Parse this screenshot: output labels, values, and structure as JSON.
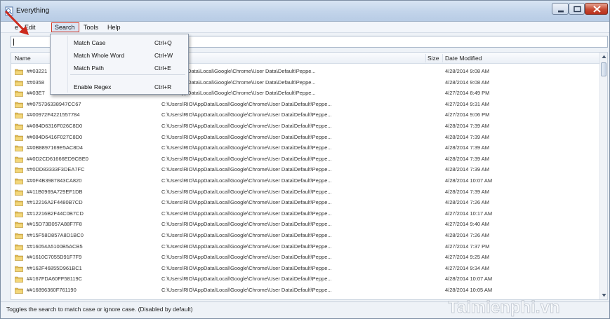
{
  "window": {
    "title": "Everything"
  },
  "menubar": {
    "items": [
      {
        "label": "File",
        "visible_text": "e"
      },
      {
        "label": "Edit"
      },
      {
        "label": "Search"
      },
      {
        "label": "Tools"
      },
      {
        "label": "Help"
      }
    ]
  },
  "search": {
    "value": ""
  },
  "columns": {
    "name": "Name",
    "size": "Size",
    "date": "Date Modified"
  },
  "dropdown": {
    "items": [
      {
        "label": "Match Case",
        "shortcut": "Ctrl+Q"
      },
      {
        "label": "Match Whole Word",
        "shortcut": "Ctrl+W"
      },
      {
        "label": "Match Path",
        "shortcut": "Ctrl+E"
      },
      {
        "label": "Enable Regex",
        "shortcut": "Ctrl+R"
      }
    ]
  },
  "rows": [
    {
      "name": "##03221",
      "path": "...\\RIO\\AppData\\Local\\Google\\Chrome\\User Data\\Default\\Peppe...",
      "date": "4/28/2014 9:08 AM"
    },
    {
      "name": "##0358",
      "path": "...\\RIO\\AppData\\Local\\Google\\Chrome\\User Data\\Default\\Peppe...",
      "date": "4/28/2014 9:08 AM"
    },
    {
      "name": "##03E7",
      "path": "...\\RIO\\AppData\\Local\\Google\\Chrome\\User Data\\Default\\Peppe...",
      "date": "4/27/2014 8:49 PM"
    },
    {
      "name": "##075736338947CC67",
      "path": "C:\\Users\\RIO\\AppData\\Local\\Google\\Chrome\\User Data\\Default\\Peppe...",
      "date": "4/27/2014 9:31 AM"
    },
    {
      "name": "##00972F4221557784",
      "path": "C:\\Users\\RIO\\AppData\\Local\\Google\\Chrome\\User Data\\Default\\Peppe...",
      "date": "4/27/2014 9:06 PM"
    },
    {
      "name": "##084D6316F026C8D0",
      "path": "C:\\Users\\RIO\\AppData\\Local\\Google\\Chrome\\User Data\\Default\\Peppe...",
      "date": "4/28/2014 7:39 AM"
    },
    {
      "name": "##084D6416F027C8D0",
      "path": "C:\\Users\\RIO\\AppData\\Local\\Google\\Chrome\\User Data\\Default\\Peppe...",
      "date": "4/28/2014 7:39 AM"
    },
    {
      "name": "##0B8897169E5AC8D4",
      "path": "C:\\Users\\RIO\\AppData\\Local\\Google\\Chrome\\User Data\\Default\\Peppe...",
      "date": "4/28/2014 7:39 AM"
    },
    {
      "name": "##0D2CD61666ED9CBE0",
      "path": "C:\\Users\\RIO\\AppData\\Local\\Google\\Chrome\\User Data\\Default\\Peppe...",
      "date": "4/28/2014 7:39 AM"
    },
    {
      "name": "##0DD83333F3DEA7FC",
      "path": "C:\\Users\\RIO\\AppData\\Local\\Google\\Chrome\\User Data\\Default\\Peppe...",
      "date": "4/28/2014 7:39 AM"
    },
    {
      "name": "##0F4B3987843CA820",
      "path": "C:\\Users\\RIO\\AppData\\Local\\Google\\Chrome\\User Data\\Default\\Peppe...",
      "date": "4/28/2014 10:07 AM"
    },
    {
      "name": "##11B0969A729EF1DB",
      "path": "C:\\Users\\RIO\\AppData\\Local\\Google\\Chrome\\User Data\\Default\\Peppe...",
      "date": "4/28/2014 7:39 AM"
    },
    {
      "name": "##12216A2F4480B7CD",
      "path": "C:\\Users\\RIO\\AppData\\Local\\Google\\Chrome\\User Data\\Default\\Peppe...",
      "date": "4/28/2014 7:26 AM"
    },
    {
      "name": "##12216B2F44C0B7CD",
      "path": "C:\\Users\\RIO\\AppData\\Local\\Google\\Chrome\\User Data\\Default\\Peppe...",
      "date": "4/27/2014 10:17 AM"
    },
    {
      "name": "##15D73B057A88F7F8",
      "path": "C:\\Users\\RIO\\AppData\\Local\\Google\\Chrome\\User Data\\Default\\Peppe...",
      "date": "4/27/2014 9:40 AM"
    },
    {
      "name": "##15F58D857A8D1BC0",
      "path": "C:\\Users\\RIO\\AppData\\Local\\Google\\Chrome\\User Data\\Default\\Peppe...",
      "date": "4/28/2014 7:26 AM"
    },
    {
      "name": "##16054A5100B5ACB5",
      "path": "C:\\Users\\RIO\\AppData\\Local\\Google\\Chrome\\User Data\\Default\\Peppe...",
      "date": "4/27/2014 7:37 PM"
    },
    {
      "name": "##1610C7055D91F7F9",
      "path": "C:\\Users\\RIO\\AppData\\Local\\Google\\Chrome\\User Data\\Default\\Peppe...",
      "date": "4/27/2014 9:25 AM"
    },
    {
      "name": "##162F46855D961BC1",
      "path": "C:\\Users\\RIO\\AppData\\Local\\Google\\Chrome\\User Data\\Default\\Peppe...",
      "date": "4/27/2014 9:34 AM"
    },
    {
      "name": "##167FDA60FF58119C",
      "path": "C:\\Users\\RIO\\AppData\\Local\\Google\\Chrome\\User Data\\Default\\Peppe...",
      "date": "4/28/2014 10:07 AM"
    },
    {
      "name": "##16896360F761190",
      "path": "C:\\Users\\RIO\\AppData\\Local\\Google\\Chrome\\User Data\\Default\\Peppe...",
      "date": "4/28/2014 10:05 AM"
    }
  ],
  "status": {
    "text": "Toggles the search to match case or ignore case. (Disabled by default)"
  },
  "watermark": {
    "text": "Taimienphi.vn"
  },
  "colors": {
    "highlight_box": "#d23a2a",
    "folder_yellow": "#e8c25a",
    "title_gradient": "#c2d4ea"
  }
}
